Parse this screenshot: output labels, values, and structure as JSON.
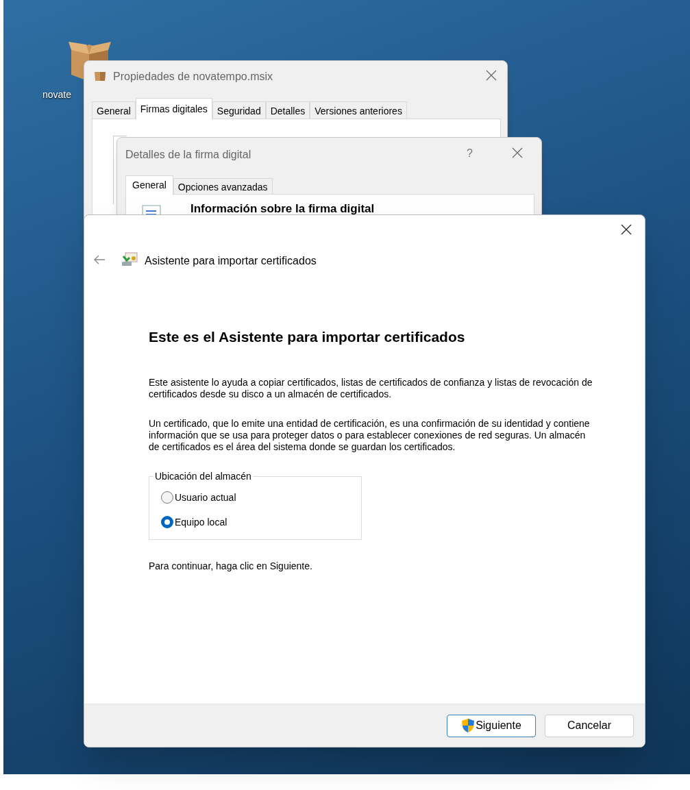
{
  "desktop_icon": {
    "label": "novate"
  },
  "properties_window": {
    "title": "Propiedades de novatempo.msix",
    "tabs": [
      {
        "label": "General",
        "selected": false
      },
      {
        "label": "Firmas digitales",
        "selected": true
      },
      {
        "label": "Seguridad",
        "selected": false
      },
      {
        "label": "Detalles",
        "selected": false
      },
      {
        "label": "Versiones anteriores",
        "selected": false
      }
    ]
  },
  "signature_window": {
    "title": "Detalles de la firma digital",
    "help": "?",
    "tabs": [
      {
        "label": "General",
        "selected": true
      },
      {
        "label": "Opciones avanzadas",
        "selected": false
      }
    ],
    "heading": "Información sobre la firma digital"
  },
  "wizard": {
    "title": "Asistente para importar certificados",
    "heading": "Este es el Asistente para importar certificados",
    "paragraphs": [
      "Este asistente lo ayuda a copiar certificados, listas de certificados de confianza y listas de revocación de certificados desde su disco a un almacén de certificados.",
      "Un certificado, que lo emite una entidad de certificación, es una confirmación de su identidad y contiene información que se usa para proteger datos o para establecer conexiones de red seguras. Un almacén de certificados es el área del sistema donde se guardan los certificados."
    ],
    "store_group": {
      "label": "Ubicación del almacén",
      "options": [
        {
          "label": "Usuario actual",
          "selected": false
        },
        {
          "label": "Equipo local",
          "selected": true
        }
      ]
    },
    "hint": "Para continuar, haga clic en Siguiente.",
    "buttons": [
      {
        "label": "Siguiente",
        "kind": "primary"
      },
      {
        "label": "Cancelar",
        "kind": "normal"
      }
    ]
  }
}
